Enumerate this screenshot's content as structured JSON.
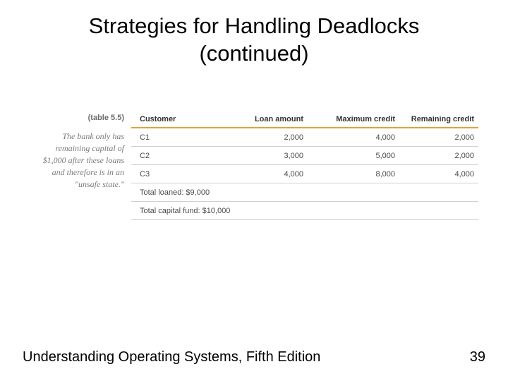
{
  "title_line1": "Strategies for Handling Deadlocks",
  "title_line2": "(continued)",
  "sidecap": {
    "label": "(table 5.5)",
    "text": "The bank only has remaining capital of $1,000 after these loans and therefore is in an \"unsafe state.\""
  },
  "headers": {
    "customer": "Customer",
    "loan": "Loan amount",
    "max": "Maximum credit",
    "remain": "Remaining credit"
  },
  "rows": [
    {
      "customer": "C1",
      "loan": "2,000",
      "max": "4,000",
      "remain": "2,000"
    },
    {
      "customer": "C2",
      "loan": "3,000",
      "max": "5,000",
      "remain": "2,000"
    },
    {
      "customer": "C3",
      "loan": "4,000",
      "max": "8,000",
      "remain": "4,000"
    }
  ],
  "total_loaned": "Total loaned: $9,000",
  "total_fund": "Total capital fund: $10,000",
  "footer_left": "Understanding Operating Systems, Fifth Edition",
  "footer_right": "39",
  "chart_data": {
    "type": "table",
    "title": "table 5.5 — Bank loan example (unsafe state)",
    "columns": [
      "Customer",
      "Loan amount",
      "Maximum credit",
      "Remaining credit"
    ],
    "rows": [
      [
        "C1",
        2000,
        4000,
        2000
      ],
      [
        "C2",
        3000,
        5000,
        2000
      ],
      [
        "C3",
        4000,
        8000,
        4000
      ]
    ],
    "totals": {
      "total_loaned": 9000,
      "total_capital_fund": 10000,
      "remaining_capital": 1000
    },
    "note": "The bank only has remaining capital of $1,000 after these loans and therefore is in an \"unsafe state.\""
  }
}
